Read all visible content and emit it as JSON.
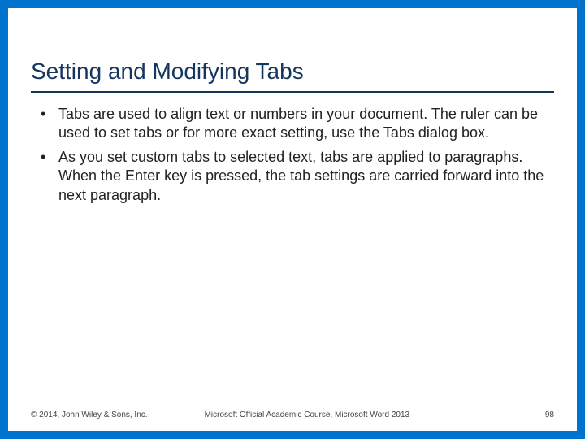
{
  "slide": {
    "title": "Setting and Modifying Tabs",
    "bullets": [
      "Tabs are used to align text or numbers in your document. The ruler can be used to set tabs or for more exact setting, use the Tabs dialog box.",
      "As you set custom tabs to selected text, tabs are applied to paragraphs. When the Enter key is pressed, the tab settings are carried forward into the next paragraph."
    ]
  },
  "footer": {
    "copyright": "© 2014, John Wiley & Sons, Inc.",
    "course": "Microsoft Official Academic Course, Microsoft Word 2013",
    "page": "98"
  }
}
